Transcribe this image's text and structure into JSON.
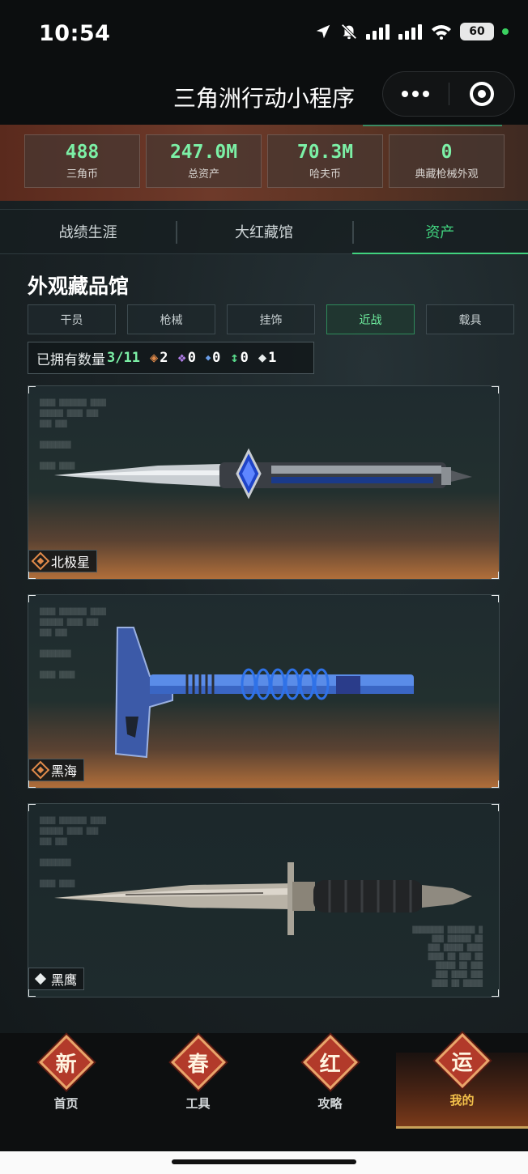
{
  "status_bar": {
    "time": "10:54",
    "battery": "60",
    "icons": [
      "location-arrow-icon",
      "bell-muted-icon",
      "cellular-signal-icon",
      "cellular-signal-icon",
      "wifi-icon",
      "battery-icon"
    ]
  },
  "nav": {
    "title": "三角洲行动小程序"
  },
  "stats": [
    {
      "value": "488",
      "label": "三角币"
    },
    {
      "value": "247.0M",
      "label": "总资产"
    },
    {
      "value": "70.3M",
      "label": "哈夫币"
    },
    {
      "value": "0",
      "label": "典藏枪械外观"
    }
  ],
  "tabs": [
    {
      "label": "战绩生涯",
      "active": false
    },
    {
      "label": "大红藏馆",
      "active": false
    },
    {
      "label": "资产",
      "active": true
    }
  ],
  "section": {
    "title": "外观藏品馆"
  },
  "filters": [
    {
      "label": "干员",
      "active": false
    },
    {
      "label": "枪械",
      "active": false
    },
    {
      "label": "挂饰",
      "active": false
    },
    {
      "label": "近战",
      "active": true
    },
    {
      "label": "载具",
      "active": false
    }
  ],
  "owned": {
    "label": "已拥有数量",
    "count": "3/11",
    "rarities": [
      {
        "color": "#e08a4a",
        "count": "2"
      },
      {
        "color": "#b07de8",
        "count": "0"
      },
      {
        "color": "#6a9ee8",
        "count": "0"
      },
      {
        "color": "#58d88a",
        "count": "0"
      },
      {
        "color": "#e8ecec",
        "count": "1"
      }
    ]
  },
  "items": [
    {
      "name": "北极星",
      "rarity": "orange"
    },
    {
      "name": "黑海",
      "rarity": "orange"
    },
    {
      "name": "黑鹰",
      "rarity": "white"
    }
  ],
  "bottom_nav": [
    {
      "icon_char": "新",
      "label": "首页",
      "active": false
    },
    {
      "icon_char": "春",
      "label": "工具",
      "active": false
    },
    {
      "icon_char": "红",
      "label": "攻略",
      "active": false
    },
    {
      "icon_char": "运",
      "label": "我的",
      "active": true
    }
  ]
}
